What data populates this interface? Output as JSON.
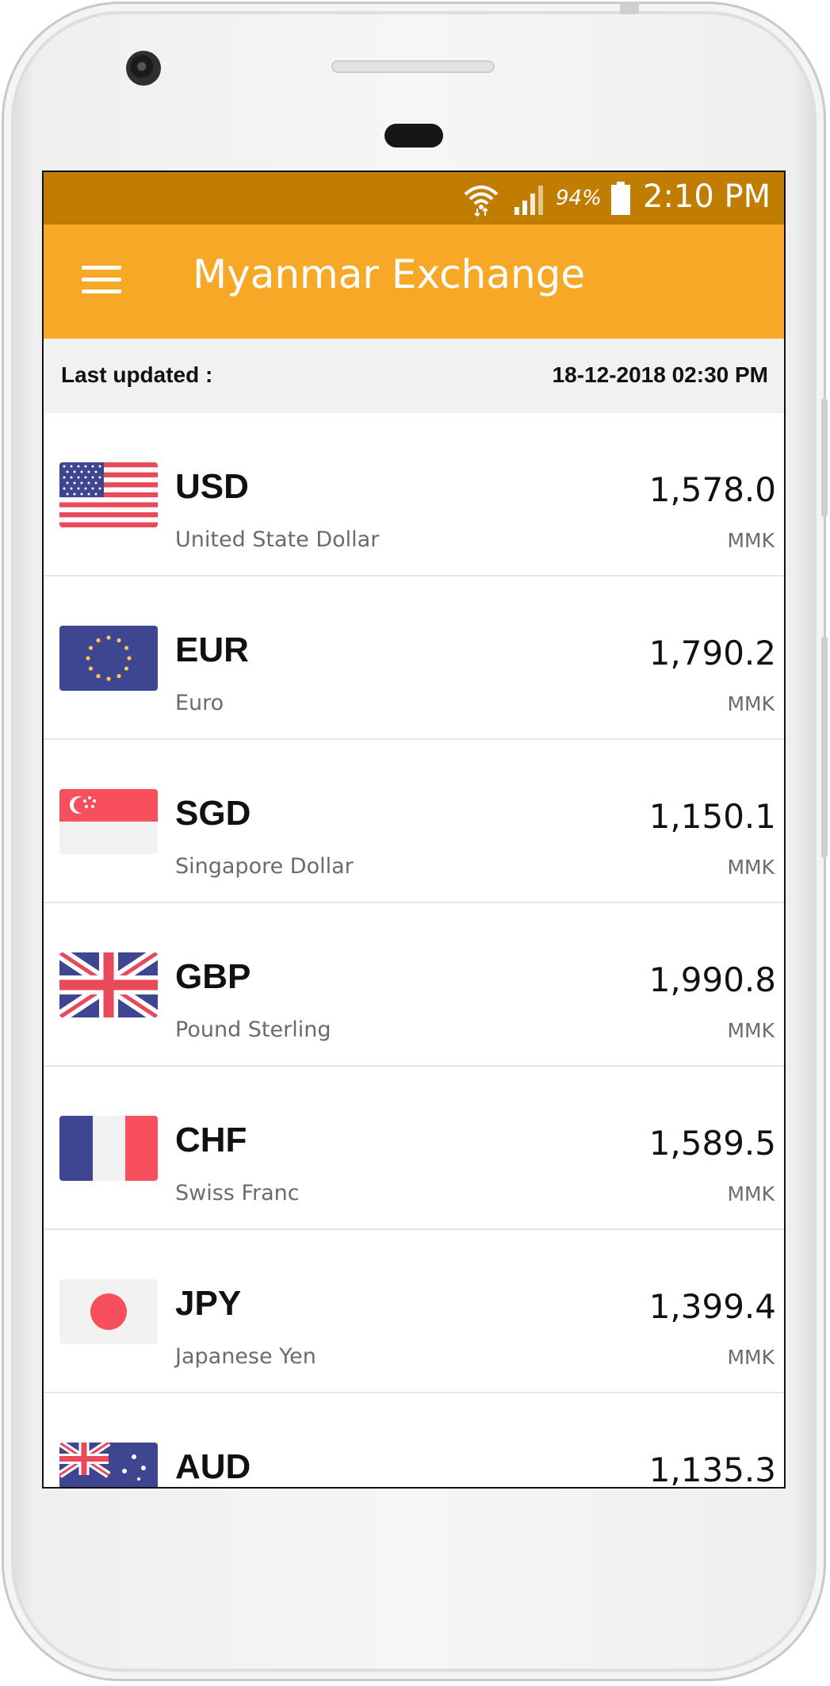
{
  "status_bar": {
    "battery": "94%",
    "time": "2:10 PM",
    "icons": [
      "wifi-icon",
      "signal-icon",
      "battery-icon"
    ]
  },
  "app_bar": {
    "title": "Myanmar Exchange",
    "menu_icon": "hamburger-menu-icon"
  },
  "updated": {
    "label": "Last updated :",
    "value": "18-12-2018 02:30 PM"
  },
  "colors": {
    "status_bar": "#c17d00",
    "app_bar": "#f6a826",
    "updated_bg": "#f1f1f1"
  },
  "currencies": [
    {
      "code": "USD",
      "name": "United State Dollar",
      "rate": "1,578.0",
      "unit": "MMK",
      "flag": "us-flag-icon"
    },
    {
      "code": "EUR",
      "name": "Euro",
      "rate": "1,790.2",
      "unit": "MMK",
      "flag": "eu-flag-icon"
    },
    {
      "code": "SGD",
      "name": "Singapore Dollar",
      "rate": "1,150.1",
      "unit": "MMK",
      "flag": "sg-flag-icon"
    },
    {
      "code": "GBP",
      "name": "Pound Sterling",
      "rate": "1,990.8",
      "unit": "MMK",
      "flag": "gb-flag-icon"
    },
    {
      "code": "CHF",
      "name": "Swiss Franc",
      "rate": "1,589.5",
      "unit": "MMK",
      "flag": "fr-flag-icon"
    },
    {
      "code": "JPY",
      "name": "Japanese Yen",
      "rate": "1,399.4",
      "unit": "MMK",
      "flag": "jp-flag-icon"
    },
    {
      "code": "AUD",
      "name": "",
      "rate": "1,135.3",
      "unit": "",
      "flag": "au-flag-icon"
    }
  ]
}
